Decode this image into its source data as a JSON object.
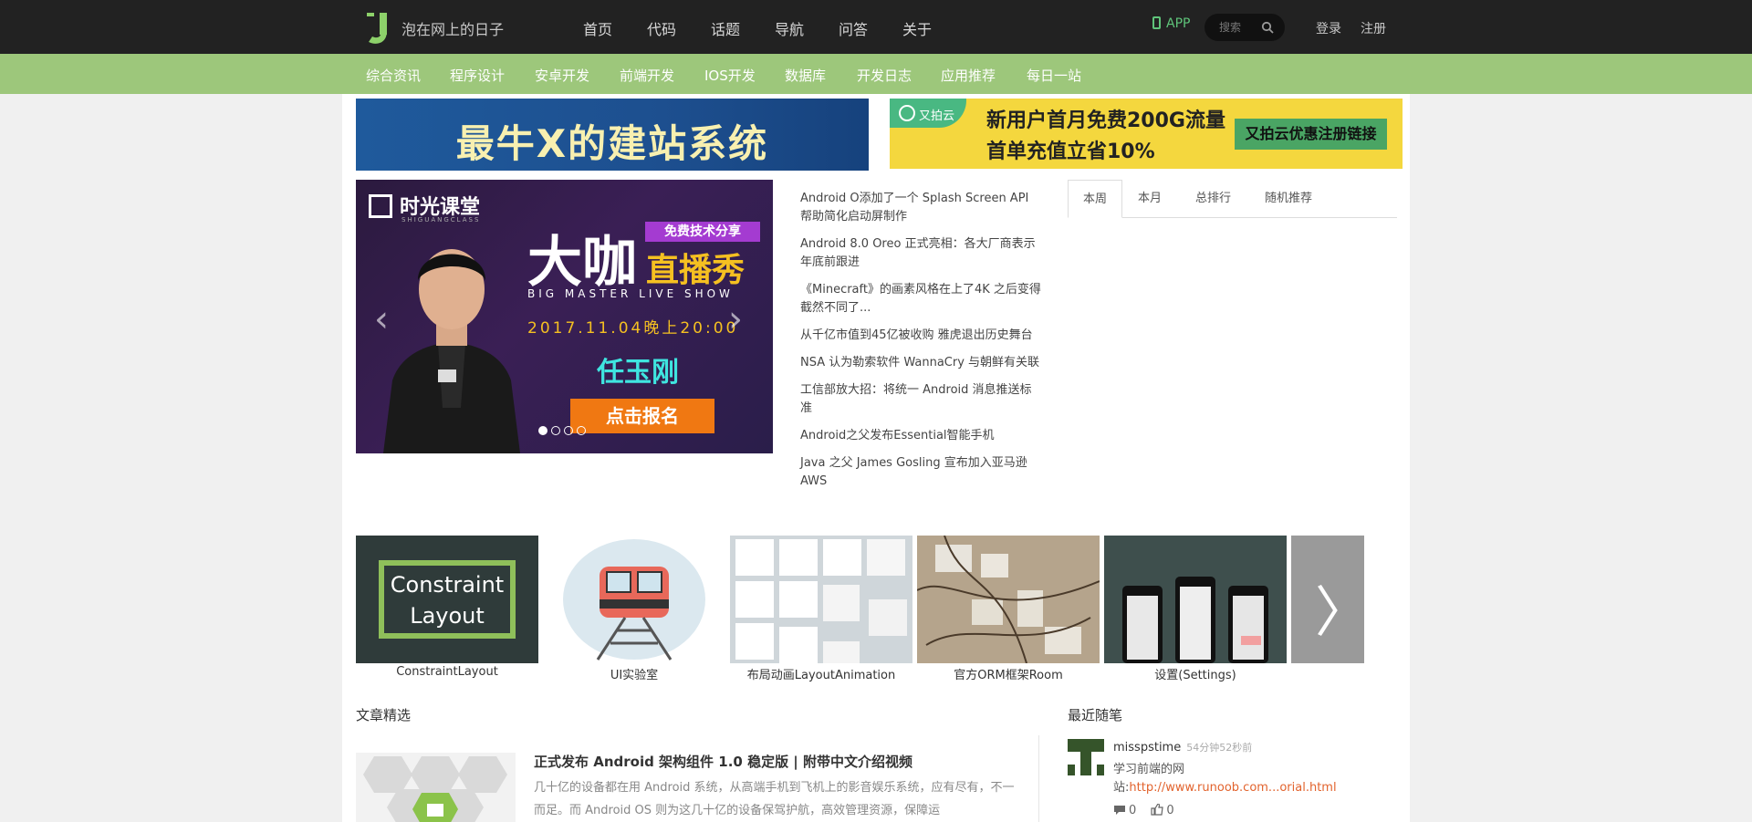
{
  "header": {
    "site_name": "泡在网上的日子",
    "nav": [
      "首页",
      "代码",
      "话题",
      "导航",
      "问答",
      "关于"
    ],
    "app_label": "APP",
    "search_placeholder": "搜索",
    "login": "登录",
    "register": "注册"
  },
  "subnav": [
    "综合资讯",
    "程序设计",
    "安卓开发",
    "前端开发",
    "IOS开发",
    "数据库",
    "开发日志",
    "应用推荐",
    "每日一站"
  ],
  "banners": {
    "left_text": "最牛X的建站系统",
    "right_brand": "又拍云",
    "right_line1": "新用户首月免费200G流量",
    "right_line2": "首单充值立省10%",
    "right_cta": "又拍云优惠注册链接"
  },
  "carousel": {
    "brand": "时光课堂",
    "brand_sub": "SHIGUANGCLASS",
    "tag": "免费技术分享",
    "big1": "大咖",
    "big2": "直播秀",
    "en": "BIG MASTER LIVE SHOW",
    "date": "2017.11.04晚上20:00",
    "speaker": "任玉刚",
    "signup": "点击报名",
    "prev": "‹",
    "next": "›",
    "slide_count": 4,
    "active_slide": 0
  },
  "news": [
    "Android O添加了一个 Splash Screen API 帮助简化启动屏制作",
    "Android 8.0 Oreo 正式亮相：各大厂商表示年底前跟进",
    "《Minecraft》的画素风格在上了4K 之后变得截然不同了...",
    "从千亿市值到45亿被收购 雅虎退出历史舞台",
    "NSA 认为勒索软件 WannaCry 与朝鲜有关联",
    "工信部放大招：将统一 Android 消息推送标准",
    "Android之父发布Essential智能手机",
    "Java 之父 James Gosling 宣布加入亚马逊 AWS"
  ],
  "tabs": [
    "本周",
    "本月",
    "总排行",
    "随机推荐"
  ],
  "thumbnails": [
    {
      "label": "ConstraintLayout",
      "image_text": [
        "Constraint",
        "Layout"
      ]
    },
    {
      "label": "UI实验室"
    },
    {
      "label": "布局动画LayoutAnimation"
    },
    {
      "label": "官方ORM框架Room"
    },
    {
      "label": "设置(Settings)"
    }
  ],
  "next_thumb": "〉",
  "featured": {
    "section_title": "文章精选",
    "title": "正式发布 Android 架构组件 1.0 稳定版 | 附带中文介绍视频",
    "summary": "几十亿的设备都在用 Android 系统，从高端手机到飞机上的影音娱乐系统，应有尽有，不一而足。而 Android OS 则为这几十亿的设备保驾护航，高效管理资源，保障运"
  },
  "recent": {
    "section_title": "最近随笔",
    "user": "misspstime",
    "time": "54分钟52秒前",
    "text": "学习前端的网站:",
    "link": "http://www.runoob.com...orial.html",
    "comments": "0",
    "likes": "0"
  },
  "colors": {
    "topbar": "#222222",
    "subnav": "#9dc77b",
    "accent": "#5fc47a",
    "link": "#e2632d"
  }
}
